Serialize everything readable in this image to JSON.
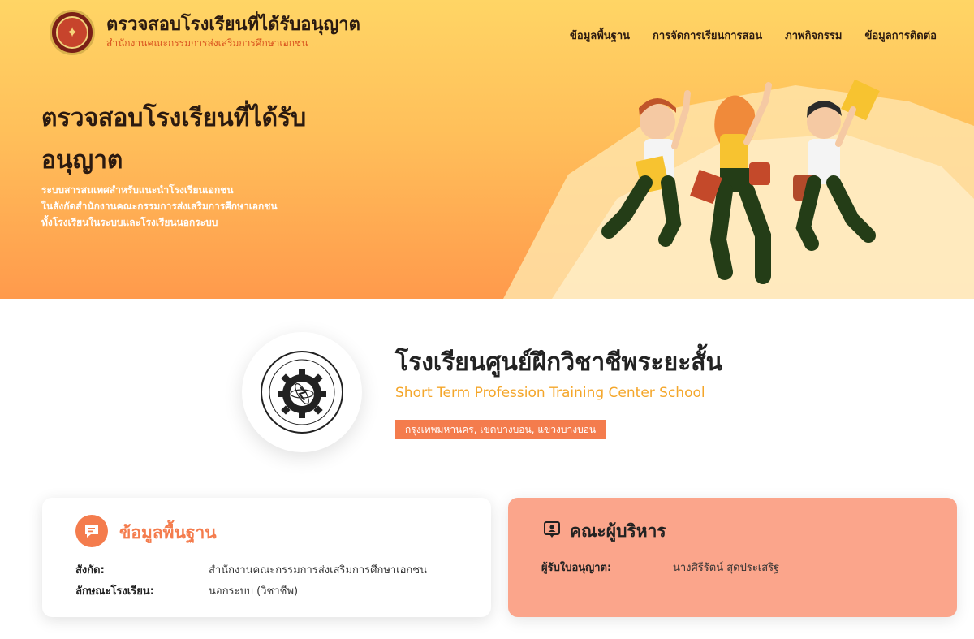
{
  "header": {
    "site_title": "ตรวจสอบโรงเรียนที่ได้รับอนุญาต",
    "site_subtitle": "สำนักงานคณะกรรมการส่งเสริมการศึกษาเอกชน",
    "nav": [
      {
        "label": "ข้อมูลพื้นฐาน"
      },
      {
        "label": "การจัดการเรียนการสอน"
      },
      {
        "label": "ภาพกิจกรรม"
      },
      {
        "label": "ข้อมูลการติดต่อ"
      }
    ]
  },
  "hero": {
    "heading": "ตรวจสอบโรงเรียนที่ได้รับอนุญาต",
    "description_lines": [
      "ระบบสารสนเทศสำหรับแนะนำโรงเรียนเอกชน",
      "ในสังกัดสำนักงานคณะกรรมการส่งเสริมการศึกษาเอกชน",
      "ทั้งโรงเรียนในระบบและโรงเรียนนอกระบบ"
    ]
  },
  "school": {
    "name_th": "โรงเรียนศูนย์ฝึกวิชาชีพระยะสั้น",
    "name_en": "Short Term Profession Training Center School",
    "location": "กรุงเทพมหานคร, เขตบางบอน, แขวงบางบอน"
  },
  "basic_info": {
    "title": "ข้อมูลพื้นฐาน",
    "rows": [
      {
        "label": "สังกัด:",
        "value": "สำนักงานคณะกรรมการส่งเสริมการศึกษาเอกชน"
      },
      {
        "label": "ลักษณะโรงเรียน:",
        "value": "นอกระบบ (วิชาชีพ)"
      }
    ]
  },
  "administrators": {
    "title": "คณะผู้บริหาร",
    "rows": [
      {
        "label": "ผู้รับใบอนุญาต:",
        "value": "นางศิรีรัตน์ สุดประเสริฐ"
      }
    ]
  },
  "colors": {
    "accent": "#f47c4d",
    "hero_top": "#ffd565",
    "hero_bottom": "#ff9a4c",
    "english_name": "#f4a62a",
    "admin_card": "#fba58b"
  },
  "icons": {
    "logo": "ministry-emblem-icon",
    "basic_info": "chat-bubble-icon",
    "administrators": "user-id-badge-icon"
  }
}
